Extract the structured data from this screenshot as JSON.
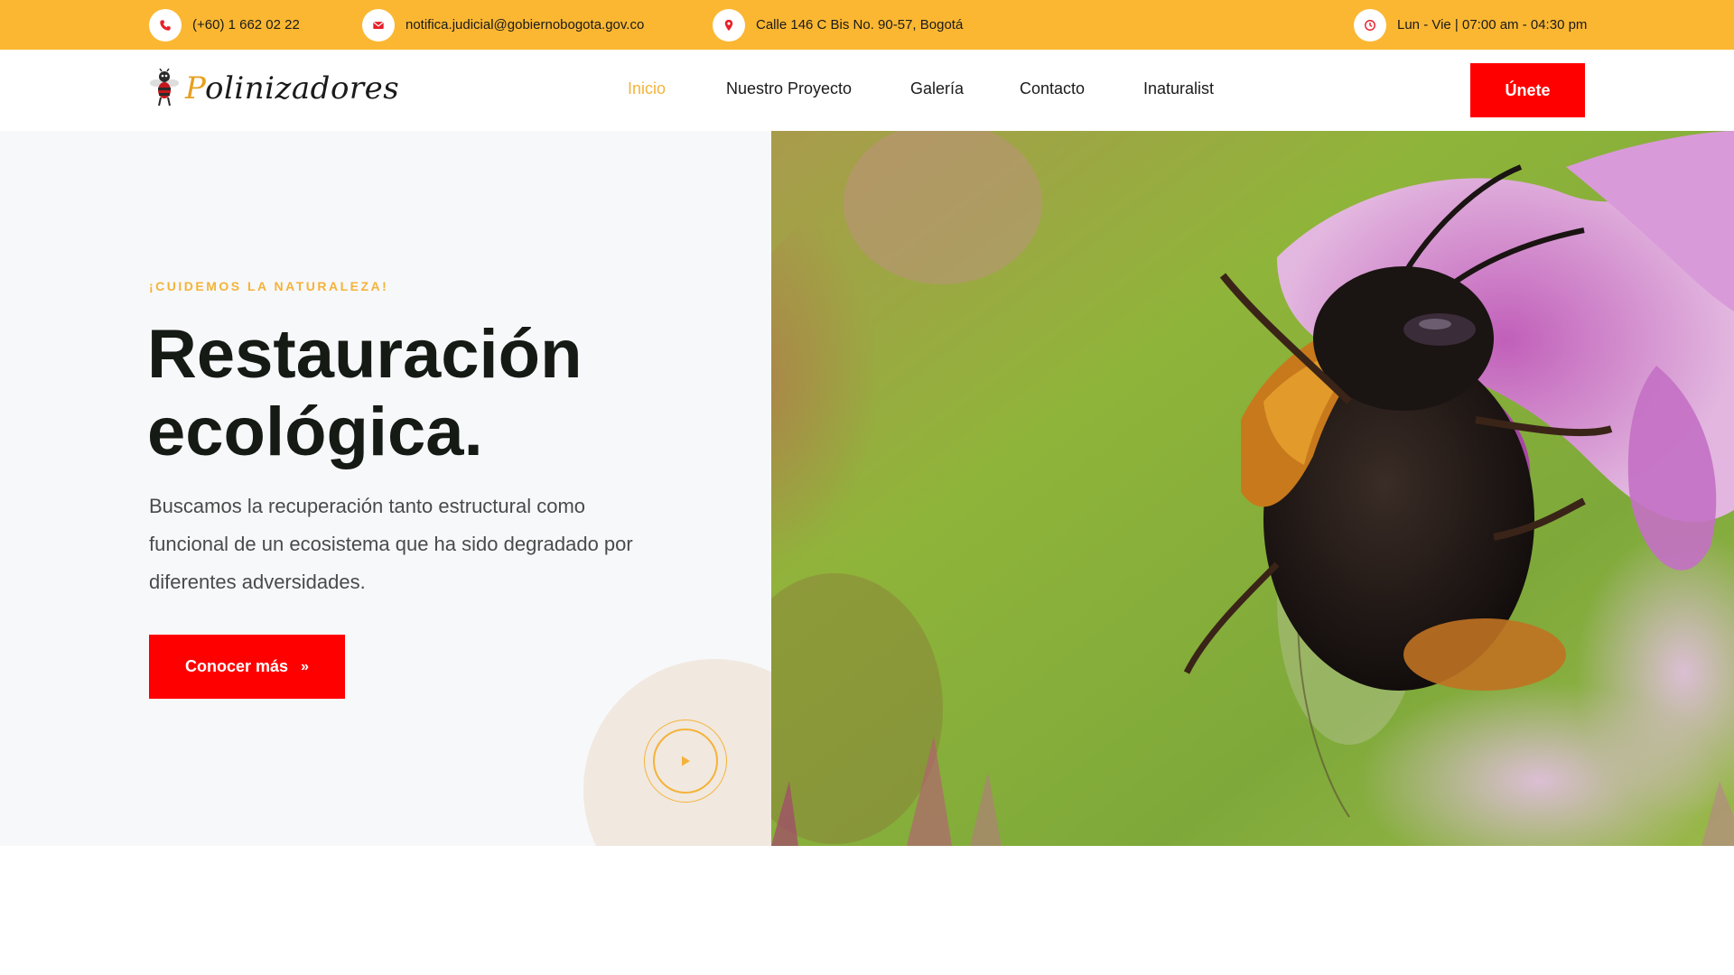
{
  "topbar": {
    "phone": "(+60) 1 662 02 22",
    "email": "notifica.judicial@gobiernobogota.gov.co",
    "address": "Calle 146 C Bis No. 90-57, Bogotá",
    "hours": "Lun - Vie | 07:00 am - 04:30 pm",
    "icons": [
      "phone-icon",
      "mail-icon",
      "location-pin-icon",
      "clock-icon"
    ],
    "icon_color": "#e8202a",
    "bar_color": "#fbb732"
  },
  "header": {
    "logo_text_first": "P",
    "logo_text_rest": "olinizadores",
    "nav": [
      {
        "label": "Inicio",
        "active": true
      },
      {
        "label": "Nuestro Proyecto",
        "active": false
      },
      {
        "label": "Galería",
        "active": false
      },
      {
        "label": "Contacto",
        "active": false
      },
      {
        "label": "Inaturalist",
        "active": false
      }
    ],
    "join_label": "Únete",
    "accent_color": "#f4b33a",
    "button_color": "#ff0000"
  },
  "hero": {
    "eyebrow": "¡CUIDEMOS LA NATURALEZA!",
    "headline_line1": "Restauración",
    "headline_line2": "ecológica.",
    "description": "Buscamos la recuperación tanto estructural como funcional de un ecosistema que ha sido degradado por diferentes adversidades.",
    "cta_label": "Conocer más",
    "cta_icon": "double-chevron-right-icon",
    "play_icon": "play-icon",
    "image": "bumblebee-on-pink-flower-photo"
  }
}
